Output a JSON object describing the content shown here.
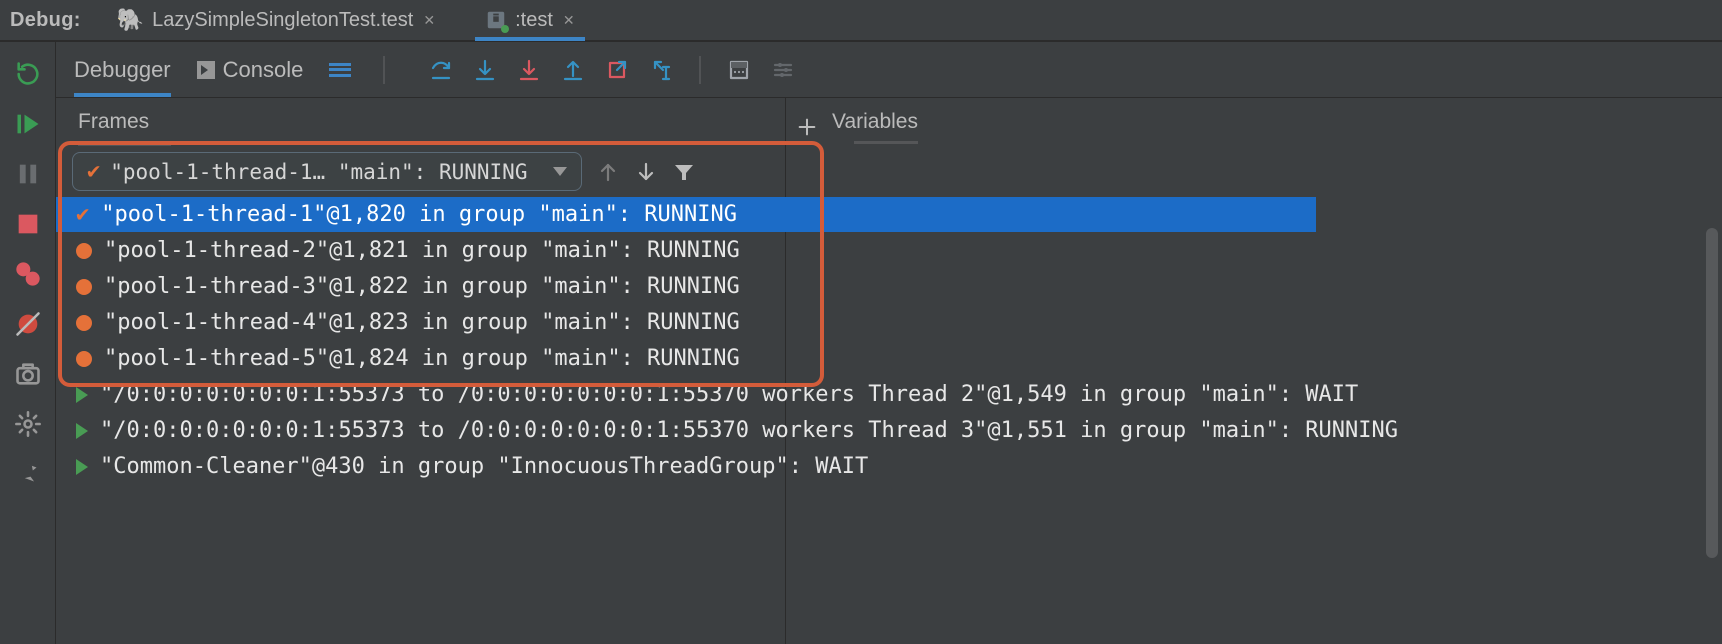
{
  "titlebar": {
    "label": "Debug:",
    "tabs": [
      {
        "icon": "elephant-icon",
        "label": "LazySimpleSingletonTest.test",
        "active": false
      },
      {
        "icon": "gradle-icon",
        "label": ":test",
        "active": true
      }
    ]
  },
  "debugger_tabs": {
    "debugger": "Debugger",
    "console": "Console"
  },
  "panels": {
    "frames": "Frames",
    "variables": "Variables"
  },
  "selector": {
    "display": "\"pool-1-thread-1… \"main\": RUNNING"
  },
  "threads": [
    {
      "icon": "check",
      "selected": true,
      "label": "\"pool-1-thread-1\"@1,820 in group \"main\": RUNNING"
    },
    {
      "icon": "dot",
      "selected": false,
      "label": "\"pool-1-thread-2\"@1,821 in group \"main\": RUNNING"
    },
    {
      "icon": "dot",
      "selected": false,
      "label": "\"pool-1-thread-3\"@1,822 in group \"main\": RUNNING"
    },
    {
      "icon": "dot",
      "selected": false,
      "label": "\"pool-1-thread-4\"@1,823 in group \"main\": RUNNING"
    },
    {
      "icon": "dot",
      "selected": false,
      "label": "\"pool-1-thread-5\"@1,824 in group \"main\": RUNNING"
    },
    {
      "icon": "tri",
      "selected": false,
      "label": "\"/0:0:0:0:0:0:0:1:55373 to /0:0:0:0:0:0:0:1:55370 workers Thread 2\"@1,549 in group \"main\": WAIT"
    },
    {
      "icon": "tri",
      "selected": false,
      "label": "\"/0:0:0:0:0:0:0:1:55373 to /0:0:0:0:0:0:0:1:55370 workers Thread 3\"@1,551 in group \"main\": RUNNING"
    },
    {
      "icon": "tri",
      "selected": false,
      "label": "\"Common-Cleaner\"@430 in group \"InnocuousThreadGroup\": WAIT"
    }
  ],
  "colors": {
    "selection": "#1c6cc7",
    "orange": "#e57139",
    "green": "#499c54",
    "accent": "#3592c4",
    "bg": "#3c3f41"
  }
}
